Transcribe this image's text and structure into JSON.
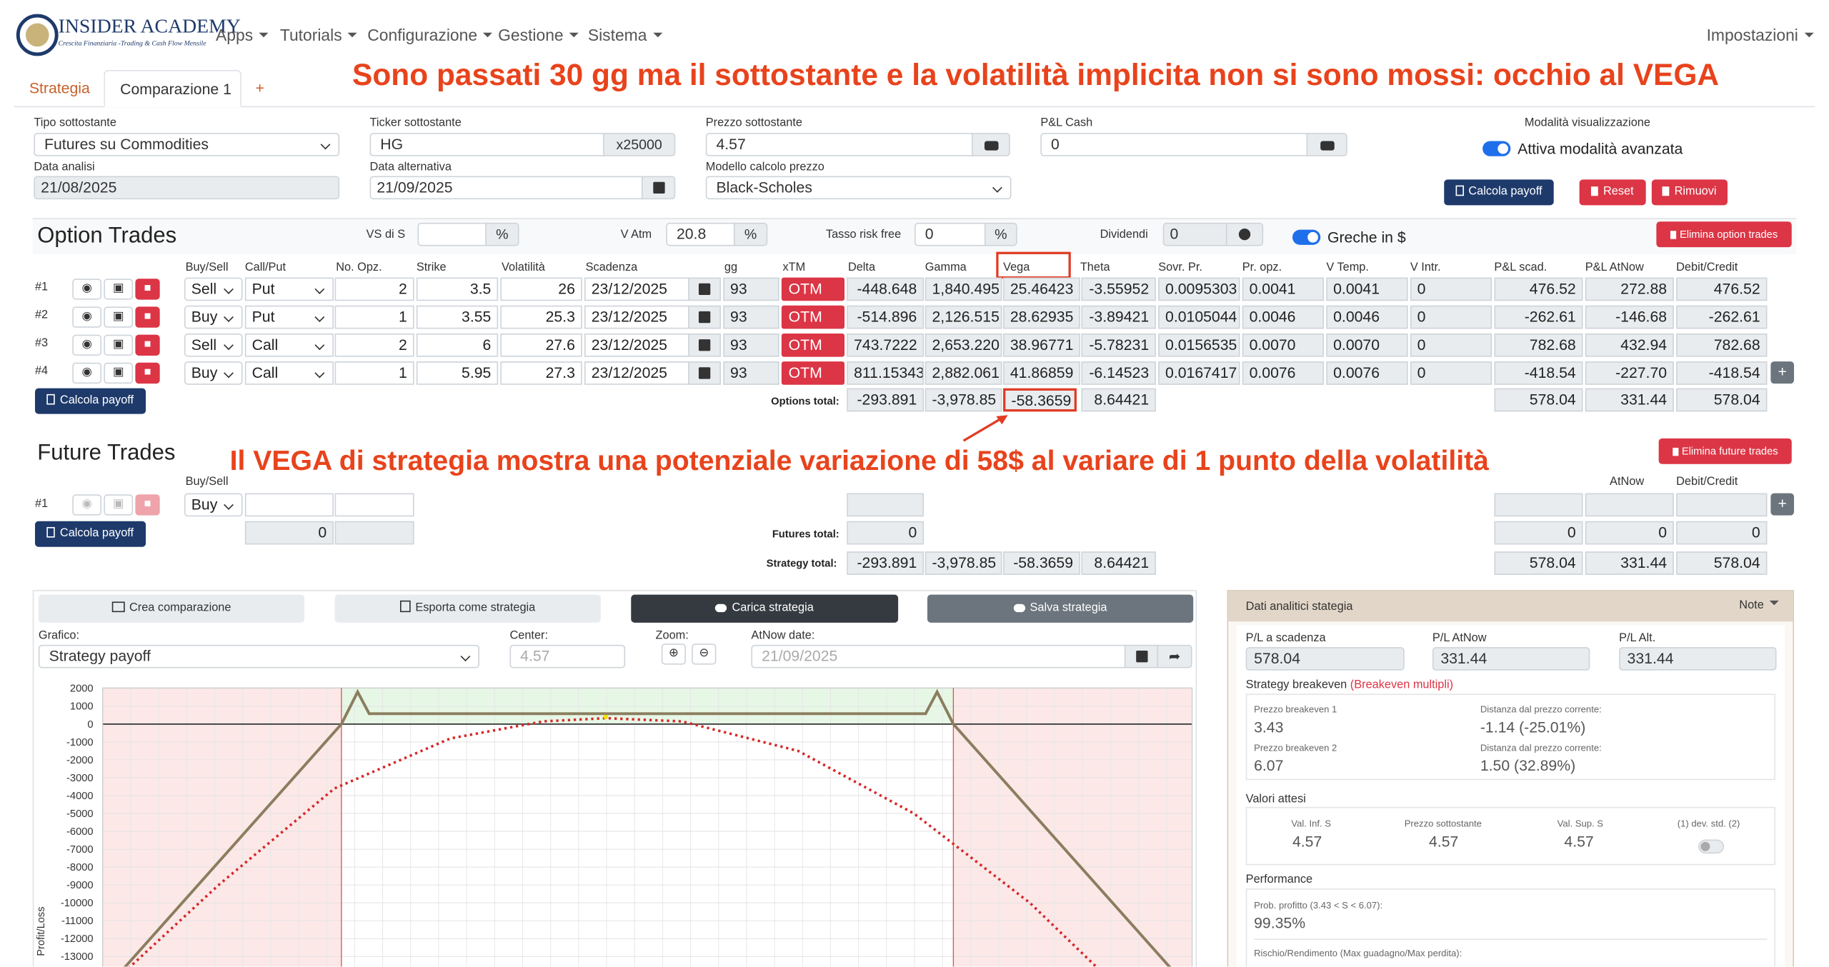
{
  "brand": {
    "name": "INSIDER ACADEMY",
    "tagline": "Crescita Finanziaria -Trading & Cash Flow Mensile"
  },
  "nav": {
    "menus": [
      "Apps",
      "Tutorials",
      "Configurazione",
      "Gestione",
      "Sistema"
    ],
    "settings": "Impostazioni"
  },
  "tabs": {
    "strategy": "Strategia",
    "comparison": "Comparazione 1",
    "add": "+"
  },
  "annotations": {
    "top": "Sono passati 30 gg ma il sottostante e la volatilità implicita non si sono mossi: occhio al VEGA",
    "middle": "Il VEGA di strategia mostra una potenziale variazione di 58$ al variare di 1 punto della volatilità"
  },
  "settings_form": {
    "tipo_label": "Tipo sottostante",
    "tipo_value": "Futures su Commodities",
    "ticker_label": "Ticker sottostante",
    "ticker_value": "HG",
    "multiplier": "x25000",
    "prezzo_label": "Prezzo sottostante",
    "prezzo_value": "4.57",
    "pl_cash_label": "P&L Cash",
    "pl_cash_value": "0",
    "mode_label": "Modalità visualizzazione",
    "mode_toggle": "Attiva modalità avanzata",
    "data_analisi_label": "Data analisi",
    "data_analisi_value": "21/08/2025",
    "data_alt_label": "Data alternativa",
    "data_alt_value": "21/09/2025",
    "modello_label": "Modello calcolo prezzo",
    "modello_value": "Black-Scholes",
    "calcola_payoff": "Calcola payoff",
    "reset": "Reset",
    "rimuovi": "Rimuovi"
  },
  "option_trades": {
    "title": "Option Trades",
    "vs_label": "VS di S",
    "vs_value": "",
    "vs_unit": "%",
    "vatm_label": "V Atm",
    "vatm_value": "20.8",
    "vatm_unit": "%",
    "risk_free_label": "Tasso risk free",
    "risk_free_value": "0",
    "risk_free_unit": "%",
    "dividendi_label": "Dividendi",
    "dividendi_value": "0",
    "greche_toggle": "Greche in $",
    "delete_button": "Elimina option trades",
    "columns": [
      "Buy/Sell",
      "Call/Put",
      "No. Opz.",
      "Strike",
      "Volatilità",
      "Scadenza",
      "gg",
      "xTM",
      "Delta",
      "Gamma",
      "Vega",
      "Theta",
      "Sovr. Pr.",
      "Pr. opz.",
      "V Temp.",
      "V Intr.",
      "P&L scad.",
      "P&L AtNow",
      "Debit/Credit"
    ],
    "rows": [
      {
        "id": "#1",
        "bs": "Sell",
        "cp": "Put",
        "n": "2",
        "strike": "3.5",
        "vol": "26",
        "scad": "23/12/2025",
        "gg": "93",
        "xtm": "OTM",
        "delta": "-448.648",
        "gamma": "1,840.495",
        "vega": "25.46423",
        "theta": "-3.55952",
        "sovr": "0.0095303",
        "pr": "0.0041",
        "vtemp": "0.0041",
        "vintr": "0",
        "pl_scad": "476.52",
        "pl_now": "272.88",
        "dc": "476.52"
      },
      {
        "id": "#2",
        "bs": "Buy",
        "cp": "Put",
        "n": "1",
        "strike": "3.55",
        "vol": "25.3",
        "scad": "23/12/2025",
        "gg": "93",
        "xtm": "OTM",
        "delta": "-514.896",
        "gamma": "2,126.515",
        "vega": "28.62935",
        "theta": "-3.89421",
        "sovr": "0.0105044",
        "pr": "0.0046",
        "vtemp": "0.0046",
        "vintr": "0",
        "pl_scad": "-262.61",
        "pl_now": "-146.68",
        "dc": "-262.61"
      },
      {
        "id": "#3",
        "bs": "Sell",
        "cp": "Call",
        "n": "2",
        "strike": "6",
        "vol": "27.6",
        "scad": "23/12/2025",
        "gg": "93",
        "xtm": "OTM",
        "delta": "743.7222",
        "gamma": "2,653.220",
        "vega": "38.96771",
        "theta": "-5.78231",
        "sovr": "0.0156535",
        "pr": "0.0070",
        "vtemp": "0.0070",
        "vintr": "0",
        "pl_scad": "782.68",
        "pl_now": "432.94",
        "dc": "782.68"
      },
      {
        "id": "#4",
        "bs": "Buy",
        "cp": "Call",
        "n": "1",
        "strike": "5.95",
        "vol": "27.3",
        "scad": "23/12/2025",
        "gg": "93",
        "xtm": "OTM",
        "delta": "811.15343",
        "gamma": "2,882.061",
        "vega": "41.86859",
        "theta": "-6.14523",
        "sovr": "0.0167417",
        "pr": "0.0076",
        "vtemp": "0.0076",
        "vintr": "0",
        "pl_scad": "-418.54",
        "pl_now": "-227.70",
        "dc": "-418.54"
      }
    ],
    "calcola": "Calcola payoff",
    "total_label": "Options total:",
    "totals": {
      "delta": "-293.891",
      "gamma": "-3,978.85",
      "vega": "-58.3659",
      "theta": "8.64421",
      "pl_scad": "578.04",
      "pl_now": "331.44",
      "dc": "578.04"
    }
  },
  "future_trades": {
    "title": "Future Trades",
    "delete_button": "Elimina future trades",
    "col_buysell": "Buy/Sell",
    "col_atnow": "AtNow",
    "col_dc": "Debit/Credit",
    "row": {
      "id": "#1",
      "bs": "Buy"
    },
    "qty_total": "0",
    "calcola": "Calcola payoff",
    "total_label": "Futures total:",
    "totals": {
      "delta": "0",
      "pl_scad": "0",
      "pl_now": "0",
      "dc": "0"
    },
    "strategy_total_label": "Strategy total:",
    "strategy_totals": {
      "delta": "-293.891",
      "gamma": "-3,978.85",
      "vega": "-58.3659",
      "theta": "8.64421",
      "pl_scad": "578.04",
      "pl_now": "331.44",
      "dc": "578.04"
    }
  },
  "chart_section": {
    "buttons": [
      "Crea comparazione",
      "Esporta come strategia",
      "Carica strategia",
      "Salva strategia"
    ],
    "grafico_label": "Grafico:",
    "grafico_value": "Strategy payoff",
    "center_label": "Center:",
    "center_value": "4.57",
    "zoom_label": "Zoom:",
    "atnow_label": "AtNow date:",
    "atnow_value": "21/09/2025",
    "yaxis_label": "Profit/Loss"
  },
  "chart_data": {
    "type": "line",
    "ylabel": "Profit/Loss",
    "yticks": [
      2000,
      1000,
      0,
      -1000,
      -2000,
      -3000,
      -4000,
      -5000,
      -6000,
      -7000,
      -8000,
      -9000,
      -10000,
      -11000,
      -12000,
      -13000
    ],
    "series": [
      {
        "style": "solid",
        "color": "#8b7d5e",
        "points": [
          [
            2.4,
            -15000
          ],
          [
            3.43,
            0
          ],
          [
            3.5,
            1800
          ],
          [
            3.55,
            578
          ],
          [
            5.95,
            578
          ],
          [
            6.0,
            1800
          ],
          [
            6.07,
            0
          ],
          [
            7.1,
            -15000
          ]
        ]
      },
      {
        "style": "dotted",
        "color": "#d62728",
        "points": [
          [
            2.4,
            -15000
          ],
          [
            2.9,
            -9000
          ],
          [
            3.4,
            -3600
          ],
          [
            3.9,
            -800
          ],
          [
            4.3,
            150
          ],
          [
            4.57,
            331
          ],
          [
            4.9,
            150
          ],
          [
            5.4,
            -1500
          ],
          [
            5.9,
            -5000
          ],
          [
            6.4,
            -10000
          ],
          [
            6.8,
            -15000
          ]
        ]
      }
    ],
    "breakevens": [
      3.43,
      6.07
    ],
    "current_price": 4.57
  },
  "analytics": {
    "title": "Dati analitici stategia",
    "note": "Note",
    "pl_scad_label": "P/L a scadenza",
    "pl_scad_value": "578.04",
    "pl_atnow_label": "P/L AtNow",
    "pl_atnow_value": "331.44",
    "pl_alt_label": "P/L Alt.",
    "pl_alt_value": "331.44",
    "breakeven_title": "Strategy breakeven",
    "breakeven_multi": "(Breakeven multipli)",
    "be1_label": "Prezzo breakeven 1",
    "be1_value": "3.43",
    "be1_dist_label": "Distanza dal prezzo corrente:",
    "be1_dist_value": "-1.14 (-25.01%)",
    "be2_label": "Prezzo breakeven 2",
    "be2_value": "6.07",
    "be2_dist_label": "Distanza dal prezzo corrente:",
    "be2_dist_value": "1.50 (32.89%)",
    "valori_title": "Valori attesi",
    "val_inf_label": "Val. Inf. S",
    "val_inf_value": "4.57",
    "prezzo_label": "Prezzo sottostante",
    "prezzo_value": "4.57",
    "val_sup_label": "Val. Sup. S",
    "val_sup_value": "4.57",
    "devstd_label": "(1) dev. std. (2)",
    "performance_title": "Performance",
    "prob_label": "Prob. profitto (3.43 < S < 6.07):",
    "prob_value": "99.35%",
    "rischio_label": "Rischio/Rendimento (Max guadagno/Max perdita):"
  }
}
